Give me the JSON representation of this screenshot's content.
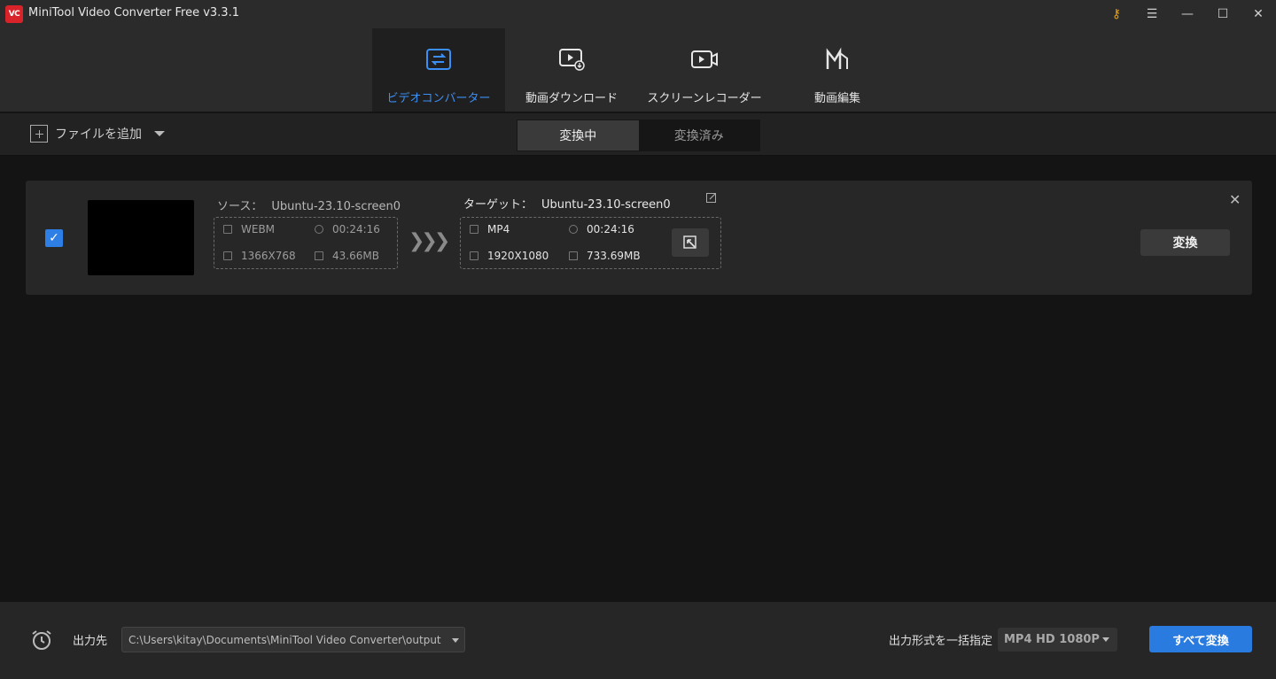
{
  "app": {
    "logo_text": "VC",
    "title": "MiniTool Video Converter Free v3.3.1"
  },
  "window_controls": [
    "key-icon",
    "menu-icon",
    "minimize-icon",
    "maximize-icon",
    "close-icon"
  ],
  "nav": {
    "tabs": [
      {
        "label": "ビデオコンバーター",
        "icon": "convert-icon",
        "active": true
      },
      {
        "label": "動画ダウンロード",
        "icon": "download-icon",
        "active": false
      },
      {
        "label": "スクリーンレコーダー",
        "icon": "record-icon",
        "active": false
      },
      {
        "label": "動画編集",
        "icon": "edit-movie-icon",
        "active": false
      }
    ]
  },
  "toolbar": {
    "add_file_label": "ファイルを追加",
    "segments": [
      {
        "label": "変換中",
        "active": true
      },
      {
        "label": "変換済み",
        "active": false
      }
    ]
  },
  "task": {
    "checked": true,
    "source_label": "ソース：",
    "source_name": "Ubuntu-23.10-screen0",
    "target_label": "ターゲット：",
    "target_name": "Ubuntu-23.10-screen0",
    "source": {
      "format": "WEBM",
      "duration": "00:24:16",
      "resolution": "1366X768",
      "size": "43.66MB"
    },
    "target": {
      "format": "MP4",
      "duration": "00:24:16",
      "resolution": "1920X1080",
      "size": "733.69MB"
    },
    "convert_label": "変換"
  },
  "bottom": {
    "output_label": "出力先",
    "output_path": "C:\\Users\\kitay\\Documents\\MiniTool Video Converter\\output",
    "format_label": "出力形式を一括指定",
    "format_value": "MP4 HD 1080P",
    "convert_all_label": "すべて変換"
  },
  "colors": {
    "accent": "#2a7be0",
    "active_tab_text": "#3b8ff5",
    "logo": "#d8232a"
  }
}
